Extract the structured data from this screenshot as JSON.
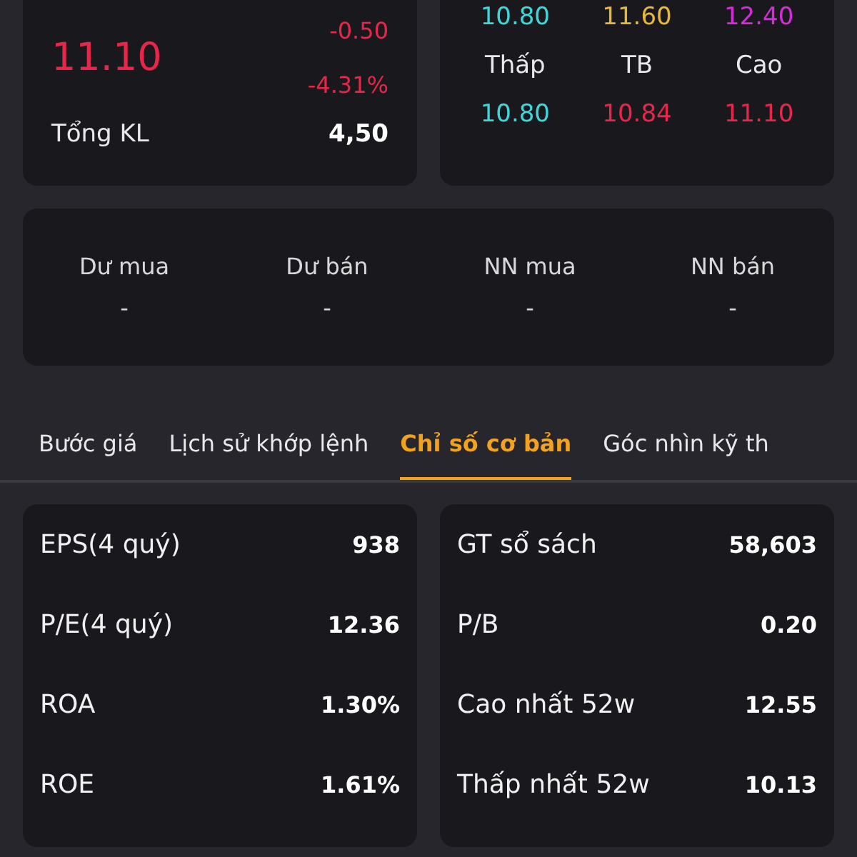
{
  "quote": {
    "color": "#e8264a",
    "price": "11.10",
    "change": "-0.50",
    "change_pct": "-4.31%",
    "volume_label": "Tổng KL",
    "volume": "4,50"
  },
  "price_range": {
    "top_values": [
      {
        "value": "10.80",
        "color": "#3fd5d9"
      },
      {
        "value": "11.60",
        "color": "#e5b83a"
      },
      {
        "value": "12.40",
        "color": "#d52bd8"
      }
    ],
    "cells": [
      {
        "label": "Thấp",
        "value": "10.80",
        "color": "#3fd5d9"
      },
      {
        "label": "TB",
        "value": "10.84",
        "color": "#e8264a"
      },
      {
        "label": "Cao",
        "value": "11.10",
        "color": "#e8264a"
      }
    ]
  },
  "orders": [
    {
      "label": "Dư mua",
      "value": "-"
    },
    {
      "label": "Dư bán",
      "value": "-"
    },
    {
      "label": "NN mua",
      "value": "-"
    },
    {
      "label": "NN bán",
      "value": "-"
    }
  ],
  "tabs": [
    {
      "label": "Bước giá",
      "selected": false
    },
    {
      "label": "Lịch sử khớp lệnh",
      "selected": false
    },
    {
      "label": "Chỉ số cơ bản",
      "selected": true
    },
    {
      "label": "Góc nhìn kỹ th",
      "selected": false
    }
  ],
  "metrics": [
    [
      {
        "label": "EPS(4 quý)",
        "value": "938"
      },
      {
        "label": "P/E(4 quý)",
        "value": "12.36"
      },
      {
        "label": "ROA",
        "value": "1.30%"
      },
      {
        "label": "ROE",
        "value": "1.61%"
      }
    ],
    [
      {
        "label": "GT sổ sách",
        "value": "58,603"
      },
      {
        "label": "P/B",
        "value": "0.20"
      },
      {
        "label": "Cao nhất 52w",
        "value": "12.55"
      },
      {
        "label": "Thấp nhất 52w",
        "value": "10.13"
      }
    ]
  ]
}
